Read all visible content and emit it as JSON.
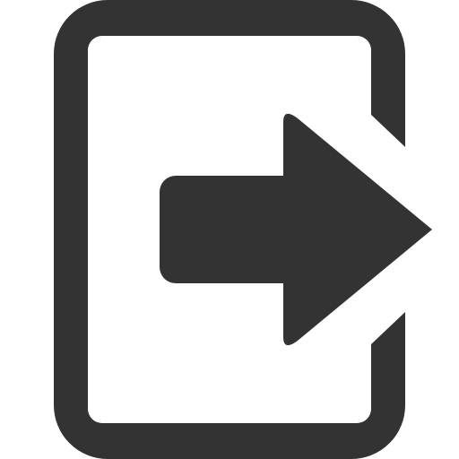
{
  "icon": {
    "name": "exit-icon",
    "color": "#333333",
    "background": "#ffffff"
  }
}
